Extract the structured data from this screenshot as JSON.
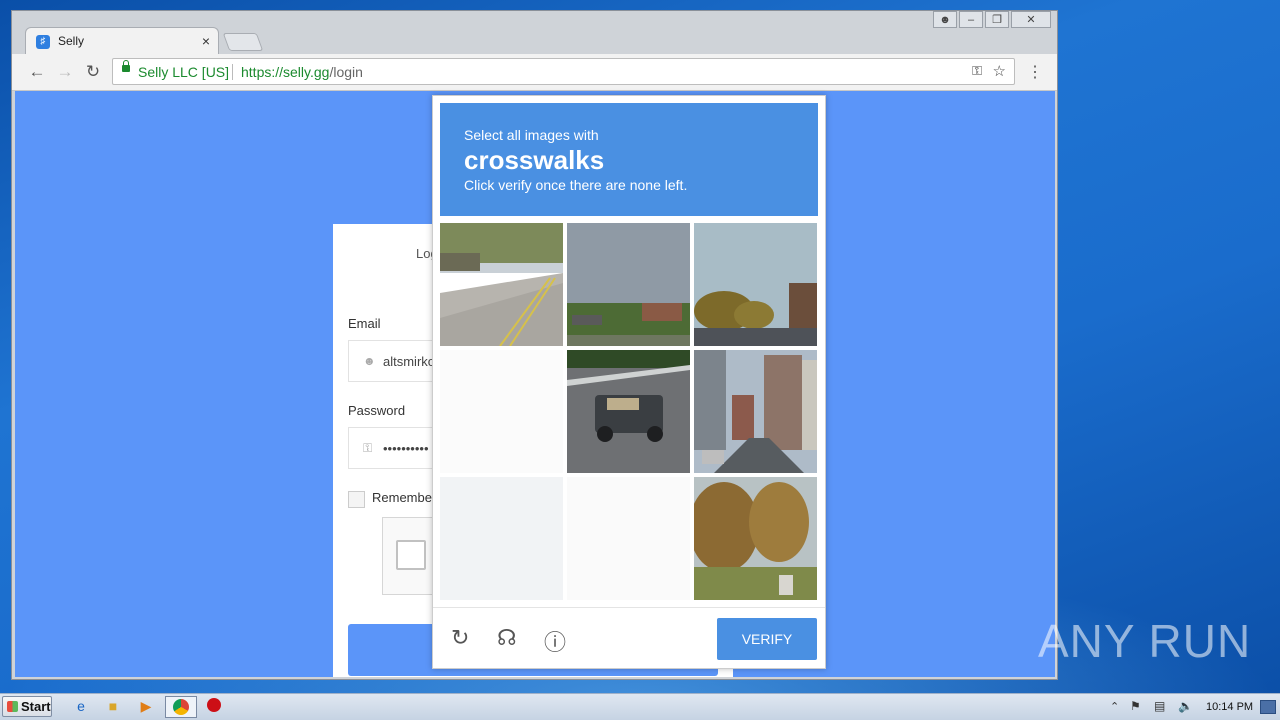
{
  "browser": {
    "tab_title": "Selly",
    "tab_close": "×",
    "security_label": "Selly LLC [US]",
    "url_host": "https://selly.gg",
    "url_path": "/login",
    "back_icon": "arrow-left",
    "forward_icon": "arrow-right",
    "reload_icon": "reload",
    "key_icon": "key",
    "star_icon": "star",
    "menu_icon": "vertical-dots"
  },
  "window_controls": [
    "user",
    "minimize",
    "restore",
    "close"
  ],
  "login": {
    "heading": "Log",
    "email_label": "Email",
    "email_value": "altsmirko",
    "password_label": "Password",
    "password_value": "••••••••••",
    "remember_label": "Remember"
  },
  "captcha": {
    "prompt_line1": "Select all images with",
    "prompt_target": "crosswalks",
    "prompt_line3": "Click verify once there are none left.",
    "verify_label": "VERIFY",
    "tiles": [
      "road-intersection",
      "field-buildings",
      "trees-parking",
      "blank-fading",
      "pickup-truck",
      "city-street",
      "blank-fading",
      "blank-fading",
      "park-trees"
    ],
    "footer_icons": [
      "reload-icon",
      "headphones-icon",
      "info-icon"
    ]
  },
  "watermark": "ANY RUN",
  "taskbar": {
    "start_label": "Start",
    "clock": "10:14 PM"
  },
  "colors": {
    "page_bg": "#5b95f9",
    "captcha_header": "#4a90e2",
    "secure_green": "#1b8a2e"
  }
}
